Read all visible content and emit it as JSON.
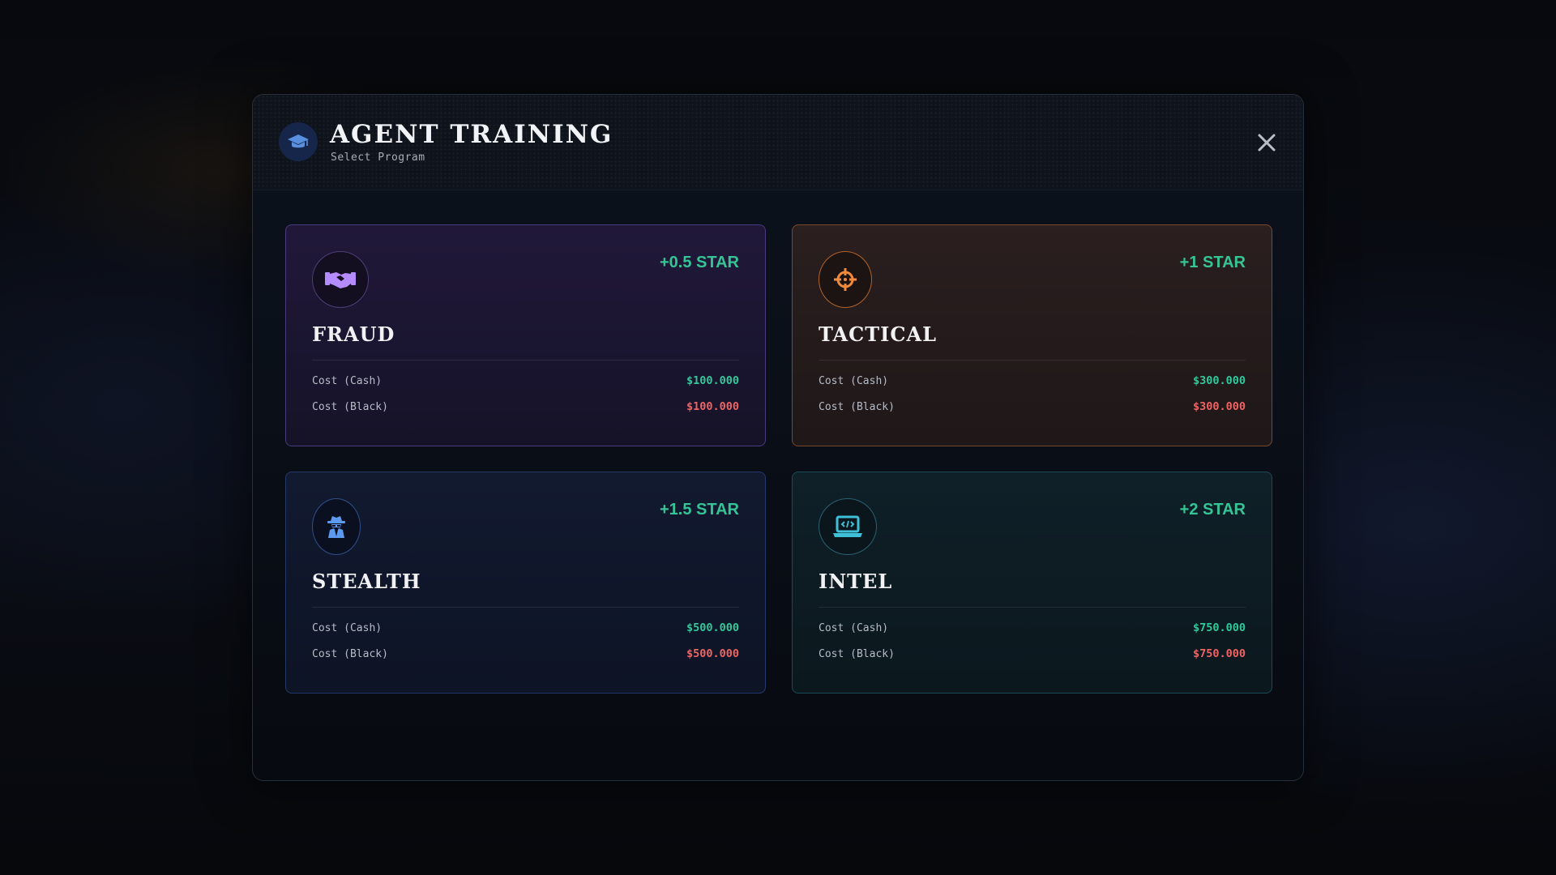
{
  "modal": {
    "title": "AGENT TRAINING",
    "subtitle": "Select Program",
    "header_icon": "graduation-cap-icon",
    "close_icon": "close-icon"
  },
  "programs": [
    {
      "name": "FRAUD",
      "star": "+0.5 STAR",
      "icon": "handshake-icon",
      "accent": "#b58cff",
      "cash_label": "Cost (Cash)",
      "cash_value": "$100.000",
      "black_label": "Cost (Black)",
      "black_value": "$100.000"
    },
    {
      "name": "TACTICAL",
      "star": "+1 STAR",
      "icon": "crosshair-icon",
      "accent": "#f08a3c",
      "cash_label": "Cost (Cash)",
      "cash_value": "$300.000",
      "black_label": "Cost (Black)",
      "black_value": "$300.000"
    },
    {
      "name": "STEALTH",
      "star": "+1.5 STAR",
      "icon": "spy-icon",
      "accent": "#5b9af0",
      "cash_label": "Cost (Cash)",
      "cash_value": "$500.000",
      "black_label": "Cost (Black)",
      "black_value": "$500.000"
    },
    {
      "name": "INTEL",
      "star": "+2 STAR",
      "icon": "laptop-code-icon",
      "accent": "#3fc0d8",
      "cash_label": "Cost (Cash)",
      "cash_value": "$750.000",
      "black_label": "Cost (Black)",
      "black_value": "$750.000"
    }
  ],
  "colors": {
    "star": "#35c495",
    "cash": "#32c99a",
    "black": "#ef6464"
  }
}
